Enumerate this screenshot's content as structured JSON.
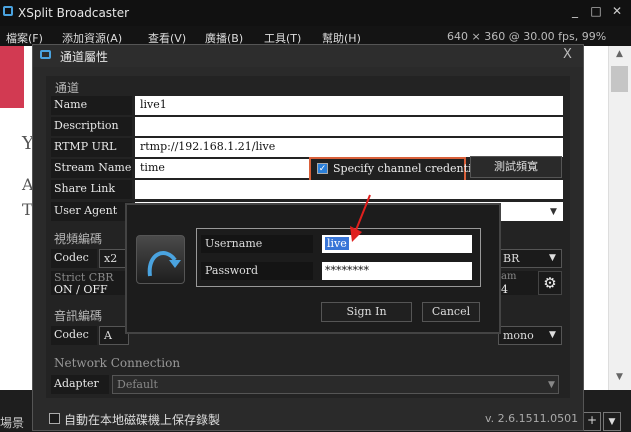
{
  "app": {
    "title": "XSplit Broadcaster",
    "minimize": "_",
    "maximize": "□",
    "close": "✕",
    "status": "640 × 360 @ 30.00 fps, 99%"
  },
  "menu": [
    "檔案(F)",
    "添加資源(A)",
    "查看(V)",
    "廣播(B)",
    "工具(T)",
    "幫助(H)"
  ],
  "preview": {
    "letters": [
      "Y",
      "A",
      "T"
    ]
  },
  "bottom": {
    "scene_label": "場景",
    "btn_plus": "+",
    "btn_down": "▼"
  },
  "dialog": {
    "title": "通道屬性",
    "close": "X",
    "channel_section": "通道",
    "fields": [
      {
        "label": "Name",
        "value": "live1"
      },
      {
        "label": "Description",
        "value": ""
      },
      {
        "label": "RTMP URL",
        "value": "rtmp://192.168.1.21/live"
      },
      {
        "label": "Stream Name",
        "value": "time"
      },
      {
        "label": "Share Link",
        "value": ""
      },
      {
        "label": "User Agent",
        "value": ""
      }
    ],
    "credentials_label": "Specify channel credentials",
    "test_button": "測試頻寬",
    "video_section": "視頻編碼",
    "codec_label": "Codec",
    "video_codec_value": "x2",
    "video_rate_value": "BR",
    "strict_cbr_label": "Strict CBR",
    "strict_cbr_value": "ON / OFF",
    "stream_label": "am",
    "stream_value": "4",
    "audio_section": "音訊編碼",
    "audio_codec_value": "A",
    "audio_channel_value": "mono",
    "network_section": "Network Connection",
    "adapter_label": "Adapter",
    "adapter_value": "Default",
    "save_local_label": "自動在本地磁碟機上保存錄製",
    "version": "v. 2.6.1511.0501"
  },
  "signin": {
    "username_label": "Username",
    "username_value": "live",
    "password_label": "Password",
    "password_value": "********",
    "signin_button": "Sign In",
    "cancel_button": "Cancel"
  },
  "colors": {
    "highlight_border": "#d9603a",
    "arrow": "#e0201e",
    "accent": "#2b7fd9",
    "preview_red": "#d23a52"
  }
}
